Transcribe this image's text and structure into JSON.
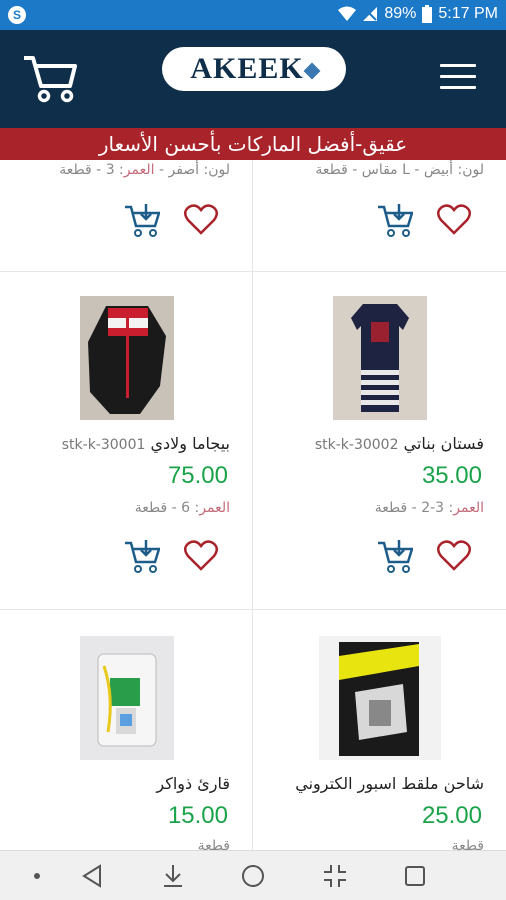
{
  "status_bar": {
    "battery": "89%",
    "time": "5:17 PM",
    "badge": "S"
  },
  "header": {
    "logo_text": "AKEEK",
    "cart_icon": "cart-icon",
    "menu_icon": "hamburger-menu-icon",
    "bg_color": "#0e2e49"
  },
  "banner": {
    "text": "عقيق-أفضل الماركات بأحسن الأسعار",
    "bg_color": "#a9232a"
  },
  "products": [
    {
      "variant_text": "لون: أبيض - L مقاس - قطعة",
      "variant_label": "",
      "variant_value": ""
    },
    {
      "variant_text": "لون: أصفر - ",
      "variant_label": "العمر",
      "variant_value": ": 3 - قطعة"
    },
    {
      "sku": "stk-k-30002",
      "title": "فستان بناتي",
      "price": "35.00",
      "variant_label": "العمر",
      "variant_value": ": 3-2 - قطعة"
    },
    {
      "sku": "stk-k-30001",
      "title": "بيجاما ولادي",
      "price": "75.00",
      "variant_label": "العمر",
      "variant_value": ": 6 - قطعة"
    },
    {
      "title": "شاحن ملقط اسبور الكتروني",
      "price": "25.00",
      "variant_value": "قطعة"
    },
    {
      "title": "قارئ ذواكر",
      "price": "15.00",
      "variant_value": "قطعة"
    }
  ],
  "price_color": "#1ba34a",
  "nav_bar": [
    "dot-icon",
    "back-icon",
    "download-icon",
    "home-icon",
    "collapse-icon",
    "recents-icon"
  ]
}
